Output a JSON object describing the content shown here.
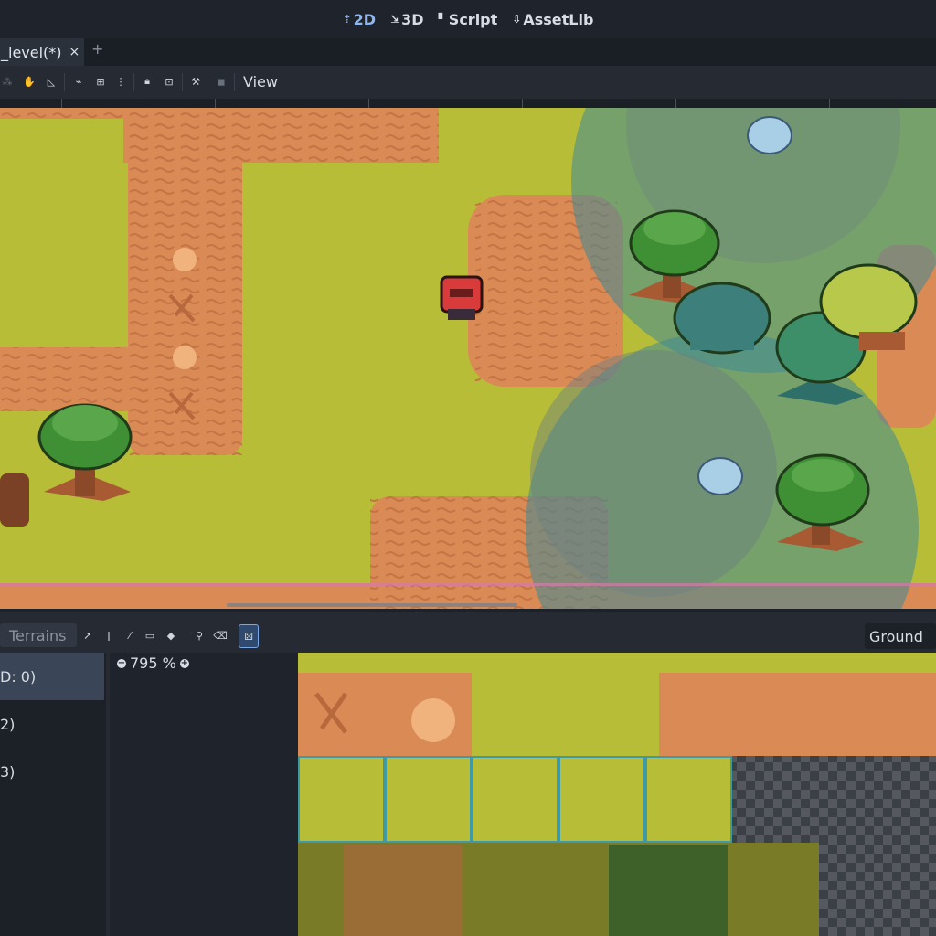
{
  "mode_tabs": [
    {
      "icon": "2d-icon",
      "label": "2D",
      "active": true
    },
    {
      "icon": "3d-icon",
      "label": "3D",
      "active": false
    },
    {
      "icon": "script-icon",
      "label": "Script",
      "active": false
    },
    {
      "icon": "assetlib-icon",
      "label": "AssetLib",
      "active": false
    }
  ],
  "scene_tab": {
    "label": "_level(*)",
    "close": "×",
    "add": "+"
  },
  "toolbar": {
    "view_label": "View"
  },
  "tilemap_panel": {
    "terrains_label": "Terrains",
    "layer_select": "Ground",
    "zoom_label": "795 %",
    "list_items": [
      "D: 0)",
      "2)",
      "3)"
    ]
  },
  "colors": {
    "accent": "#8fb8f0",
    "grass": "#b8bd38",
    "dirt": "#d98a55",
    "water_overlay": "#3f8a96",
    "tree_green": "#3f8f35"
  }
}
